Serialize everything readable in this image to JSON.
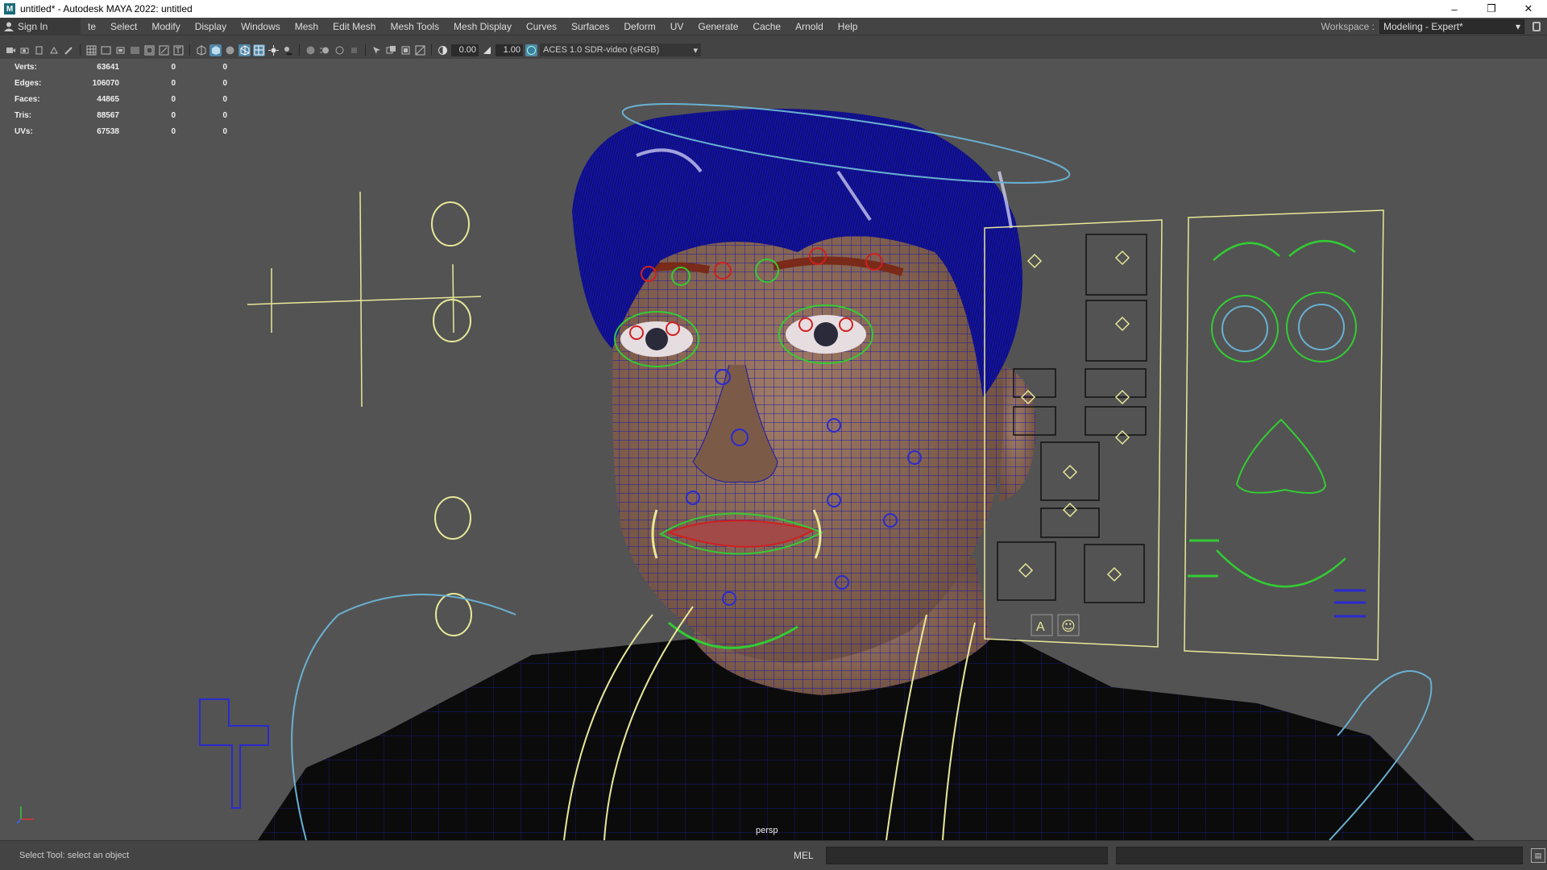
{
  "window": {
    "title": "untitled* - Autodesk MAYA 2022: untitled",
    "logo_letter": "M",
    "minimize_glyph": "–",
    "maximize_glyph": "❐",
    "close_glyph": "✕"
  },
  "menubar": {
    "sign_in": "Sign In",
    "items": [
      "te",
      "Select",
      "Modify",
      "Display",
      "Windows",
      "Mesh",
      "Edit Mesh",
      "Mesh Tools",
      "Mesh Display",
      "Curves",
      "Surfaces",
      "Deform",
      "UV",
      "Generate",
      "Cache",
      "Arnold",
      "Help"
    ],
    "workspace_label": "Workspace :",
    "workspace_value": "Modeling - Expert*"
  },
  "toolbar": {
    "exposure": "0.00",
    "gamma": "1.00",
    "color_space": "ACES 1.0 SDR-video (sRGB)"
  },
  "hud": {
    "rows": [
      {
        "label": "Verts:",
        "v1": "63641",
        "v2": "0",
        "v3": "0"
      },
      {
        "label": "Edges:",
        "v1": "106070",
        "v2": "0",
        "v3": "0"
      },
      {
        "label": "Faces:",
        "v1": "44865",
        "v2": "0",
        "v3": "0"
      },
      {
        "label": "Tris:",
        "v1": "88567",
        "v2": "0",
        "v3": "0"
      },
      {
        "label": "UVs:",
        "v1": "67538",
        "v2": "0",
        "v3": "0"
      }
    ]
  },
  "viewport": {
    "camera": "persp",
    "colors": {
      "background": "#535353",
      "wire": "#1a1aa8",
      "hair": "#1010b0",
      "skin": "#8a6a58",
      "shirt": "#0b0b0b",
      "control_yellow": "#e8e89a",
      "control_green": "#33cc33",
      "control_red": "#d02020",
      "control_cyan": "#6ab0d0",
      "control_blue": "#2a2ad0"
    },
    "picker_buttons": [
      "A",
      "☺"
    ]
  },
  "statusbar": {
    "help_line": "Select Tool: select an object",
    "mel_label": "MEL"
  }
}
